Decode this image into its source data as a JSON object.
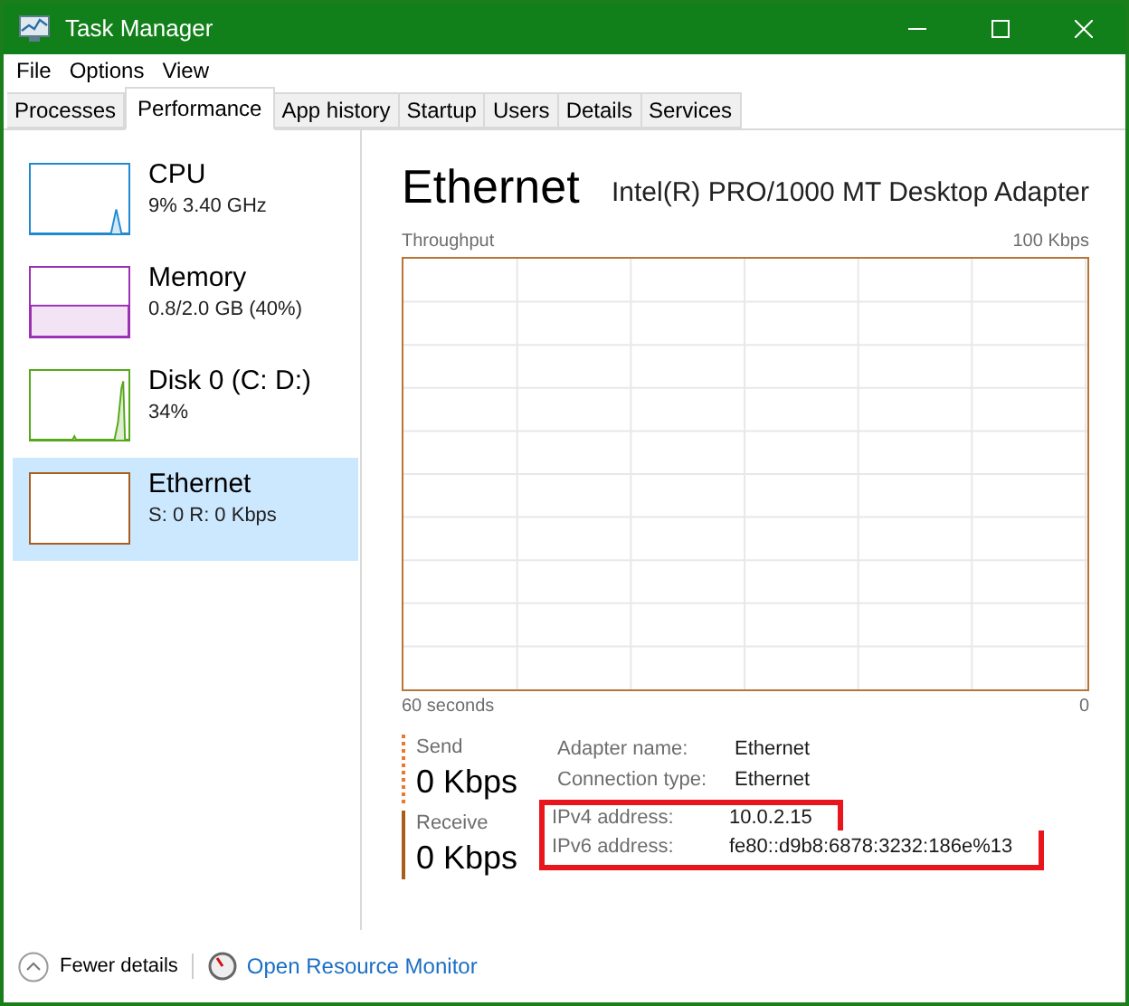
{
  "window": {
    "title": "Task Manager"
  },
  "menu": [
    "File",
    "Options",
    "View"
  ],
  "tabs": [
    {
      "label": "Processes",
      "selected": false
    },
    {
      "label": "Performance",
      "selected": true
    },
    {
      "label": "App history",
      "selected": false
    },
    {
      "label": "Startup",
      "selected": false
    },
    {
      "label": "Users",
      "selected": false
    },
    {
      "label": "Details",
      "selected": false
    },
    {
      "label": "Services",
      "selected": false
    }
  ],
  "sidebar": {
    "items": [
      {
        "kind": "cpu",
        "name": "CPU",
        "detail": "9% 3.40 GHz",
        "color": "#1f8ad2",
        "selected": false
      },
      {
        "kind": "memory",
        "name": "Memory",
        "detail": "0.8/2.0 GB (40%)",
        "color": "#9b2fb5",
        "selected": false
      },
      {
        "kind": "disk",
        "name": "Disk 0 (C: D:)",
        "detail": "34%",
        "color": "#56a81a",
        "selected": false
      },
      {
        "kind": "network",
        "name": "Ethernet",
        "detail": "S: 0 R: 0 Kbps",
        "color": "#a95d1d",
        "selected": true
      }
    ]
  },
  "detail": {
    "title": "Ethernet",
    "adapter": "Intel(R) PRO/1000 MT Desktop Adapter",
    "graph": {
      "label": "Throughput",
      "max": "100 Kbps",
      "span": "60 seconds",
      "min": "0"
    },
    "stats": [
      {
        "kind": "send",
        "label": "Send",
        "value": "0 Kbps"
      },
      {
        "kind": "receive",
        "label": "Receive",
        "value": "0 Kbps"
      }
    ],
    "properties": [
      {
        "label": "Adapter name:",
        "value": "Ethernet",
        "highlighted": false
      },
      {
        "label": "Connection type:",
        "value": "Ethernet",
        "highlighted": false
      },
      {
        "label": "IPv4 address:",
        "value": "10.0.2.15",
        "highlighted": true
      },
      {
        "label": "IPv6 address:",
        "value": "fe80::d9b8:6878:3232:186e%13",
        "highlighted": true
      }
    ]
  },
  "footer": {
    "fewer_details": "Fewer details",
    "resource_monitor": "Open Resource Monitor"
  }
}
